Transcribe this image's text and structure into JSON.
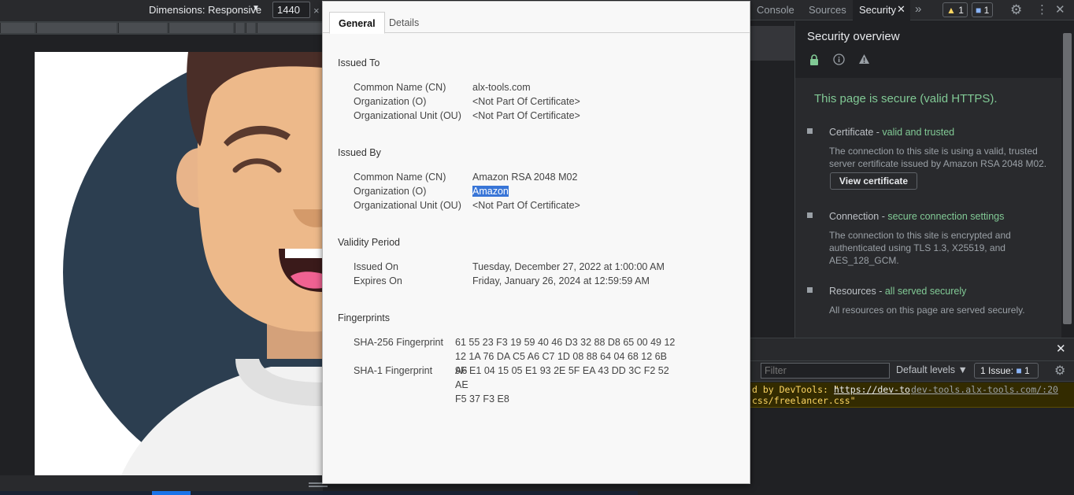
{
  "device_toolbar": {
    "dimensions_label": "Dimensions: Responsive",
    "width_value": "1440",
    "close_glyph": "×"
  },
  "cert_dialog": {
    "tabs": [
      "General",
      "Details"
    ],
    "issued_to": {
      "title": "Issued To",
      "rows": [
        {
          "label": "Common Name (CN)",
          "value": "alx-tools.com"
        },
        {
          "label": "Organization (O)",
          "value": "<Not Part Of Certificate>"
        },
        {
          "label": "Organizational Unit (OU)",
          "value": "<Not Part Of Certificate>"
        }
      ]
    },
    "issued_by": {
      "title": "Issued By",
      "rows": [
        {
          "label": "Common Name (CN)",
          "value": "Amazon RSA 2048 M02"
        },
        {
          "label": "Organization (O)",
          "value": "Amazon"
        },
        {
          "label": "Organizational Unit (OU)",
          "value": "<Not Part Of Certificate>"
        }
      ]
    },
    "validity": {
      "title": "Validity Period",
      "rows": [
        {
          "label": "Issued On",
          "value": "Tuesday, December 27, 2022 at 1:00:00 AM"
        },
        {
          "label": "Expires On",
          "value": "Friday, January 26, 2024 at 12:59:59 AM"
        }
      ]
    },
    "fingerprints": {
      "title": "Fingerprints",
      "rows": [
        {
          "label": "SHA-256 Fingerprint",
          "line1": "61 55 23 F3 19 59 40 46 D3 32 88 D8 65 00 49 12",
          "line2": "12 1A 76 DA C5 A6 C7 1D 08 88 64 04 68 12 6B A6"
        },
        {
          "label": "SHA-1 Fingerprint",
          "line1": "9F E1 04 15 05 E1 93 2E 5F EA 43 DD 3C F2 52 AE",
          "line2": "F5 37 F3 E8"
        }
      ]
    }
  },
  "devtools": {
    "tabs": {
      "console": "Console",
      "sources": "Sources",
      "security": "Security",
      "more": "»"
    },
    "warnings_count": "1",
    "messages_count": "1",
    "security": {
      "title": "Security overview",
      "secure_message": "This page is secure (valid HTTPS).",
      "certificate": {
        "head": "Certificate - ",
        "status": "valid and trusted",
        "desc": "The connection to this site is using a valid, trusted server certificate issued by Amazon RSA 2048 M02.",
        "button": "View certificate"
      },
      "connection": {
        "head": "Connection - ",
        "status": "secure connection settings",
        "desc": "The connection to this site is encrypted and authenticated using TLS 1.3, X25519, and AES_128_GCM."
      },
      "resources": {
        "head": "Resources - ",
        "status": "all served securely",
        "desc": "All resources on this page are served securely."
      }
    },
    "console": {
      "filter_placeholder": "Filter",
      "levels": "Default levels ▼",
      "issues_label": "1 Issue:",
      "issues_count": "1",
      "message_line1_prefix": "d by DevTools: \"",
      "message_line1_link": "https://dev-to",
      "message_line1_source": "dev-tools.alx-tools.com/:20",
      "message_line2": "css/freelancer.css\""
    }
  },
  "colors": {
    "secure_green": "#81c995",
    "selection_blue": "#3875d7",
    "accent_blue": "#8ab4f8"
  }
}
